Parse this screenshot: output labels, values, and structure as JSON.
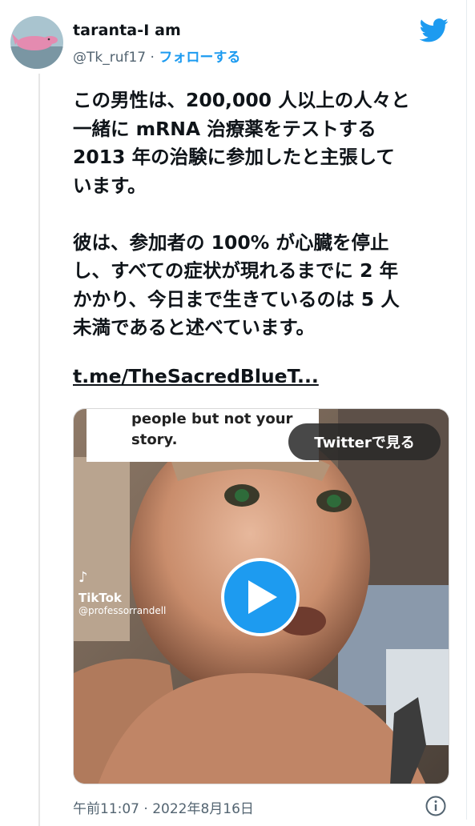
{
  "tweet": {
    "display_name": "taranta-I am",
    "handle": "@Tk_ruf17",
    "separator": "·",
    "follow_label": "フォローする",
    "text_lines": [
      "この男性は、200,000 人以上の人々と",
      "一緒に mRNA 治療薬をテストする",
      "2013 年の治験に参加したと主張して",
      "います。",
      "彼は、参加者の 100% が心臓を停止",
      "し、すべての症状が現れるまでに 2 年",
      "かかり、今日まで生きているのは 5 人",
      "未満であると述べています。"
    ],
    "link_text": "t.me/TheSacredBlueT...",
    "timestamp": "午前11:07 · 2022年8月16日"
  },
  "media": {
    "caption_lines": [
      "people but not your",
      "story."
    ],
    "watch_label": "Twitterで見る",
    "tiktok_label": "TikTok",
    "tiktok_user": "@professorrandell"
  },
  "colors": {
    "accent": "#1d9bf0",
    "text": "#0f1419",
    "muted": "#536471"
  },
  "icons": {
    "brand": "twitter-bird-icon",
    "play": "play-icon",
    "info": "info-icon"
  }
}
